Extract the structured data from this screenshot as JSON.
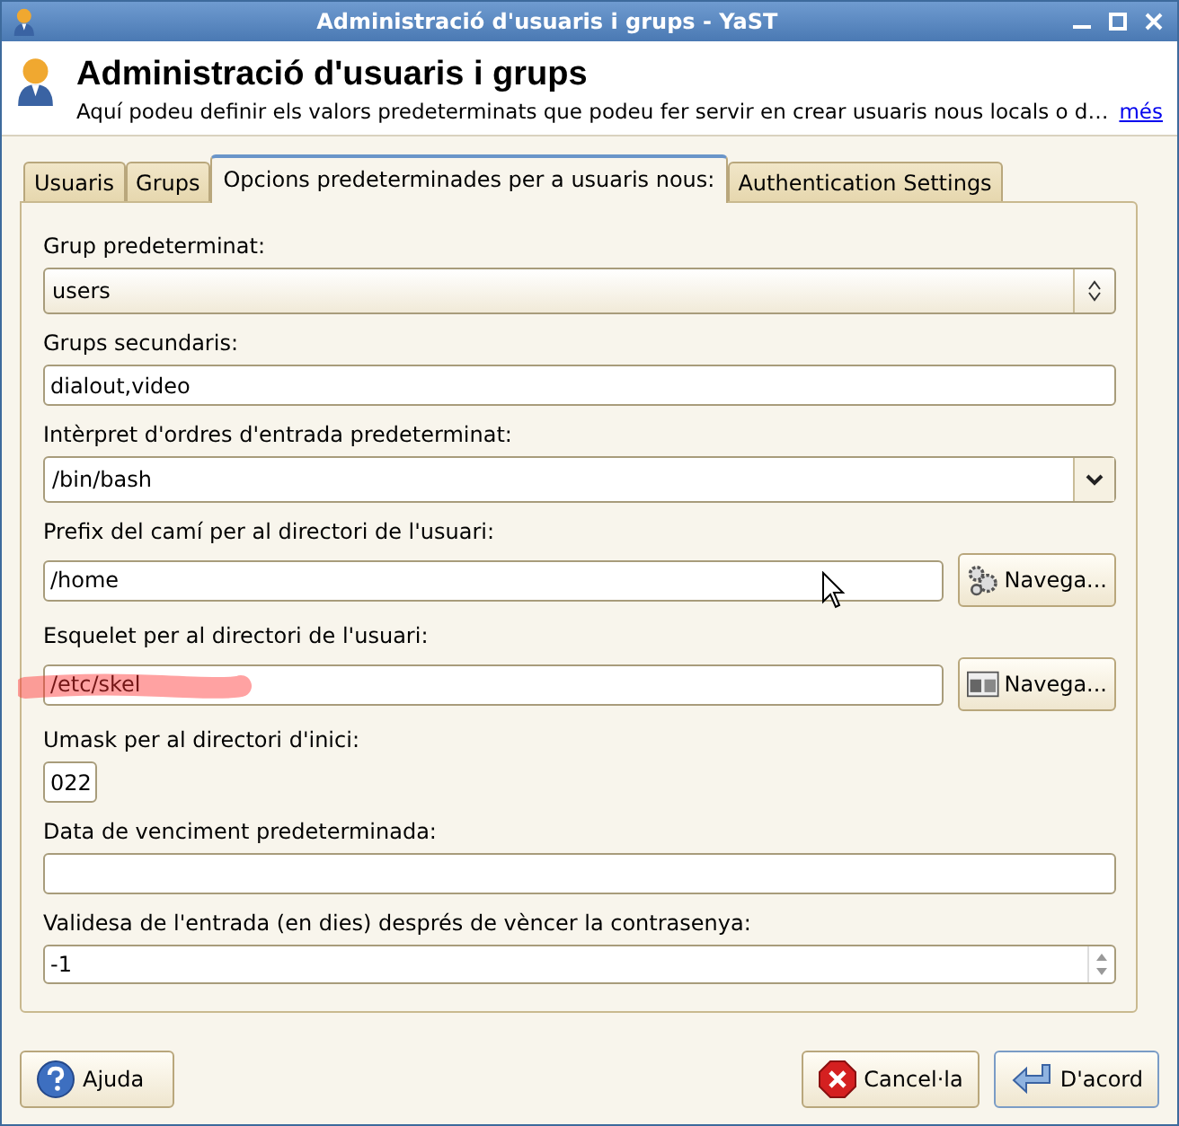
{
  "window": {
    "title": "Administració d'usuaris i grups - YaST"
  },
  "header": {
    "title": "Administració d'usuaris i grups",
    "description": "Aquí podeu definir els valors predeterminats que podeu fer servir en crear usuaris nous locals o d…",
    "more_link": "més"
  },
  "tabs": [
    {
      "label": "Usuaris",
      "selected": false
    },
    {
      "label": "Grups",
      "selected": false
    },
    {
      "label": "Opcions predeterminades per a usuaris nous:",
      "selected": true
    },
    {
      "label": "Authentication Settings",
      "selected": false
    }
  ],
  "fields": [
    {
      "kind": "combo",
      "label": "Grup predeterminat:",
      "value": "users"
    },
    {
      "kind": "text",
      "label": "Grups secundaris:",
      "value": "dialout,video"
    },
    {
      "kind": "dropdown",
      "label": "Intèrpret d'ordres d'entrada predeterminat:",
      "value": "/bin/bash"
    },
    {
      "kind": "browse",
      "label": "Prefix del camí per al directori de l'usuari:",
      "value": "/home",
      "button": "Navega..."
    },
    {
      "kind": "browse",
      "label": "Esquelet per al directori de l'usuari:",
      "value": "/etc/skel",
      "button": "Navega...",
      "highlighted": true
    },
    {
      "kind": "short",
      "label": "Umask per al directori d'inici:",
      "value": "022"
    },
    {
      "kind": "text",
      "label": "Data de venciment predeterminada:"
    },
    {
      "kind": "spin",
      "label": "Validesa de l'entrada (en dies) després de vèncer la contrasenya:",
      "value": "-1"
    }
  ],
  "buttons": [
    {
      "kind": "help",
      "label": "Ajuda"
    },
    {
      "kind": "cancel",
      "label": "Cancel·la"
    },
    {
      "kind": "ok",
      "label": "D'acord"
    }
  ]
}
